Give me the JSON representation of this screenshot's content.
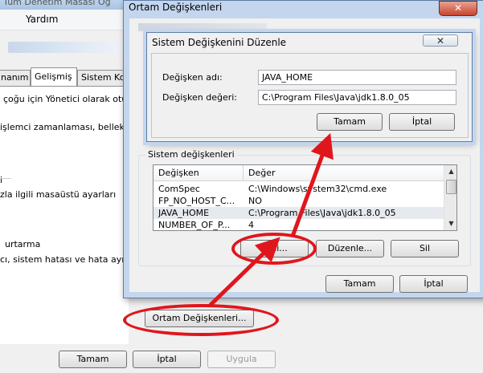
{
  "background_window": {
    "title": "Tüm Denetim Masası Öğ",
    "menu_help": "Yardım",
    "tabs": [
      "nanım",
      "Gelişmiş",
      "Sistem Ko"
    ],
    "lines": [
      "çoğu için Yönetici olarak otu",
      "işlemci zamanlaması, bellek k",
      "i",
      "zla ilgili masaüstü ayarları",
      "urtarma",
      "cı, sistem hatası ve hata ayık"
    ],
    "env_button": "Ortam Değişkenleri...",
    "ok_button": "Tamam",
    "cancel_button": "İptal",
    "apply_button": "Uygula"
  },
  "env_window": {
    "title": "Ortam Değişkenleri",
    "close_glyph": "✕",
    "system_group_label": "Sistem değişkenleri",
    "columns": [
      "Değişken",
      "Değer"
    ],
    "rows": [
      {
        "name": "ComSpec",
        "value": "C:\\Windows\\system32\\cmd.exe"
      },
      {
        "name": "FP_NO_HOST_C...",
        "value": "NO"
      },
      {
        "name": "JAVA_HOME",
        "value": "C:\\Program Files\\Java\\jdk1.8.0_05"
      },
      {
        "name": "NUMBER_OF_P...",
        "value": "4"
      }
    ],
    "new_button": "Yeni...",
    "edit_button": "Düzenle...",
    "delete_button": "Sil",
    "ok_button": "Tamam",
    "cancel_button": "İptal"
  },
  "edit_dialog": {
    "title": "Sistem Değişkenini Düzenle",
    "close_glyph": "✕",
    "name_label": "Değişken adı:",
    "name_value": "JAVA_HOME",
    "value_label": "Değişken değeri:",
    "value_value": "C:\\Program Files\\Java\\jdk1.8.0_05",
    "ok_button": "Tamam",
    "cancel_button": "İptal"
  },
  "colors": {
    "annotation_red": "#e0161d",
    "window_frame": "#c3d6ee",
    "close_red": "#c7452d"
  },
  "icons": [
    "close-icon",
    "scroll-up-icon",
    "scroll-down-icon",
    "annotation-arrow"
  ]
}
